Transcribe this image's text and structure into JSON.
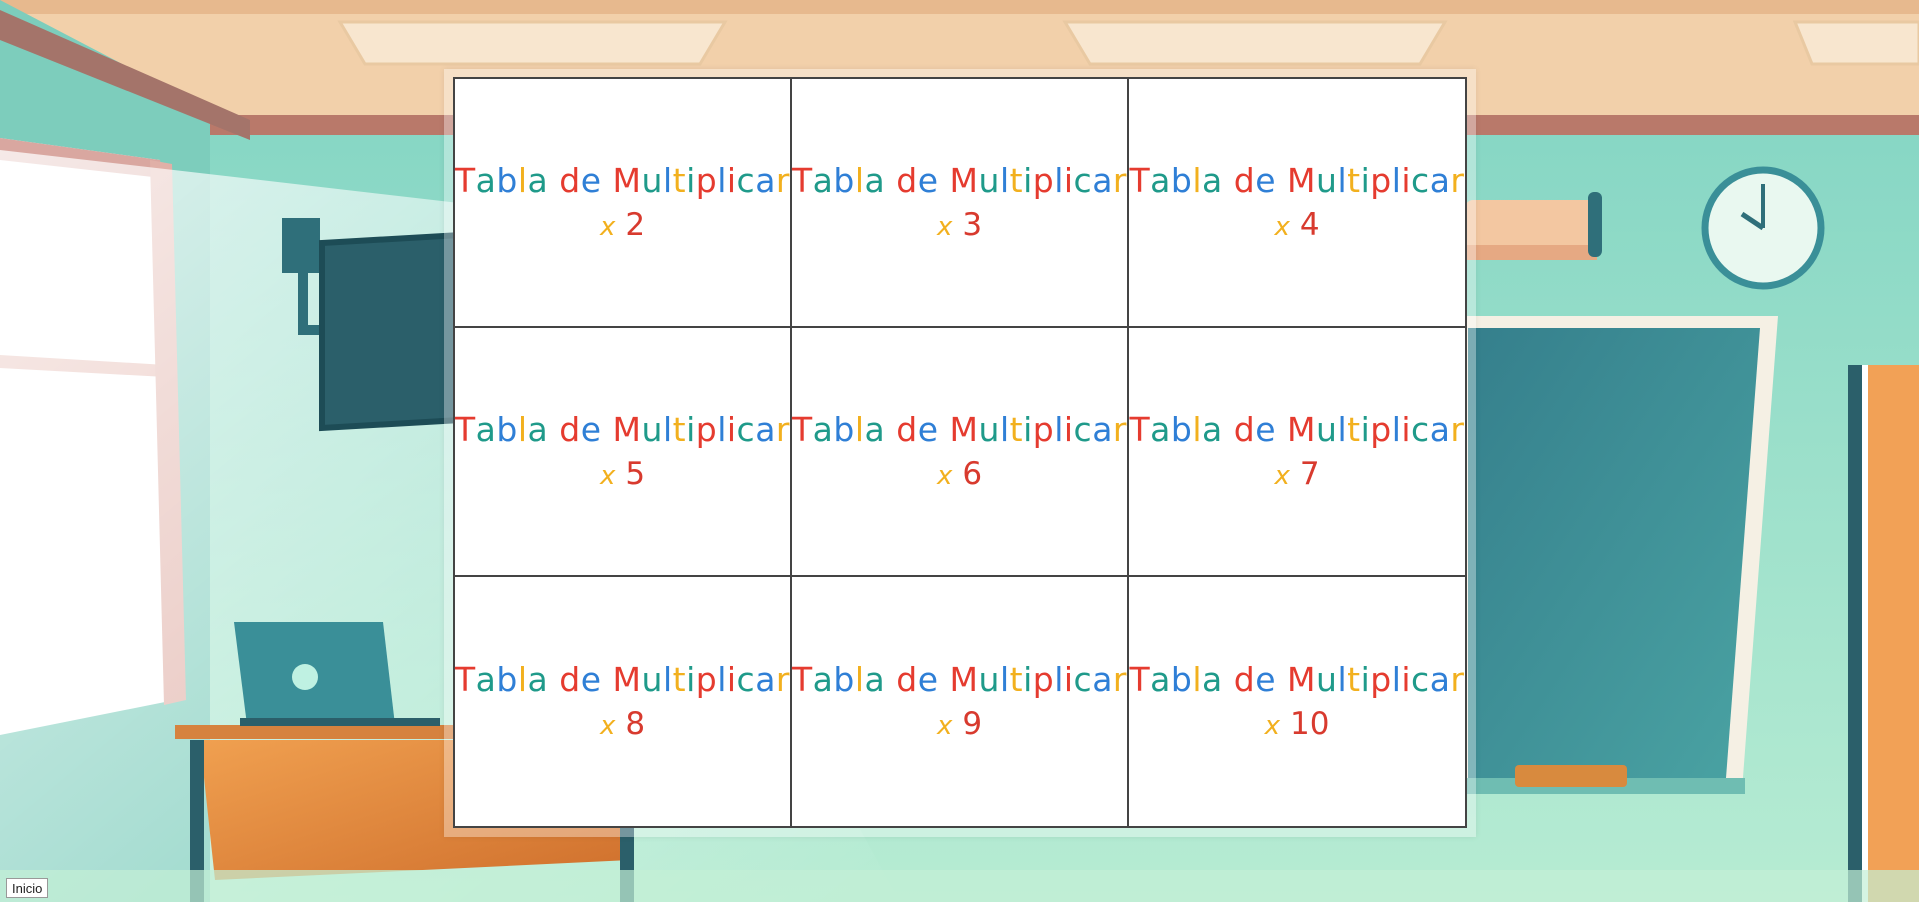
{
  "background": {
    "scene": "classroom-illustration",
    "colors": {
      "wall": "#8fd9c4",
      "ceiling": "#f3d2ae",
      "chalkboard": "#3f8f96",
      "desk": "#e0833a",
      "trim": "#a36a5e"
    }
  },
  "grid": {
    "title_text": "Tabla de Multiplicar",
    "title_palette": [
      "#e53b2f",
      "#1f9a8a",
      "#2f7fd6",
      "#f2b01e",
      "#1f9a8a",
      "#e53b2f",
      "#2f7fd6"
    ],
    "times_symbol": "x",
    "cards": [
      {
        "title": "Tabla de Multiplicar",
        "number": "2"
      },
      {
        "title": "Tabla de Multiplicar",
        "number": "3"
      },
      {
        "title": "Tabla de Multiplicar",
        "number": "4"
      },
      {
        "title": "Tabla de Multiplicar",
        "number": "5"
      },
      {
        "title": "Tabla de Multiplicar",
        "number": "6"
      },
      {
        "title": "Tabla de Multiplicar",
        "number": "7"
      },
      {
        "title": "Tabla de Multiplicar",
        "number": "8"
      },
      {
        "title": "Tabla de Multiplicar",
        "number": "9"
      },
      {
        "title": "Tabla de Multiplicar",
        "number": "10"
      }
    ]
  },
  "footer": {
    "start_label": "Inicio"
  }
}
